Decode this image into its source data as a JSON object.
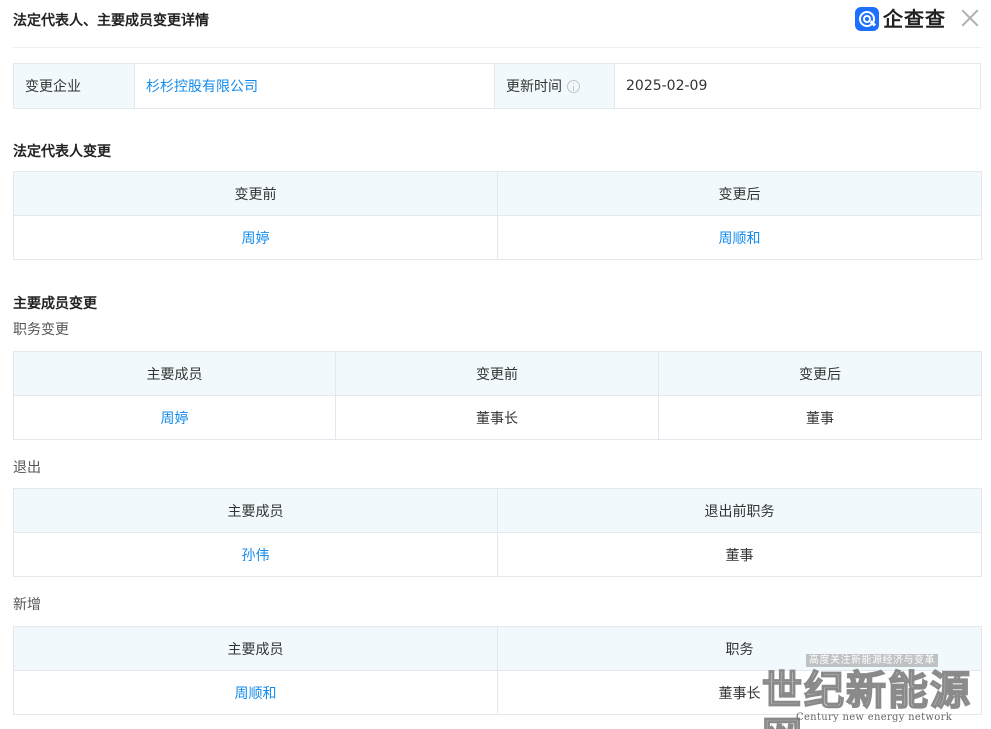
{
  "header": {
    "title": "法定代表人、主要成员变更详情",
    "brand": "企查查",
    "close_icon": "close-icon"
  },
  "info": {
    "company_label": "变更企业",
    "company_value": "杉杉控股有限公司",
    "update_label": "更新时间",
    "update_value": "2025-02-09"
  },
  "legal_rep": {
    "title": "法定代表人变更",
    "headers": [
      "变更前",
      "变更后"
    ],
    "row": [
      "周婷",
      "周顺和"
    ]
  },
  "members": {
    "title": "主要成员变更",
    "position_change": {
      "title": "职务变更",
      "headers": [
        "主要成员",
        "变更前",
        "变更后"
      ],
      "row": [
        "周婷",
        "董事长",
        "董事"
      ]
    },
    "exit": {
      "title": "退出",
      "headers": [
        "主要成员",
        "退出前职务"
      ],
      "row": [
        "孙伟",
        "董事"
      ]
    },
    "added": {
      "title": "新增",
      "headers": [
        "主要成员",
        "职务"
      ],
      "row": [
        "周顺和",
        "董事长"
      ]
    }
  },
  "watermark": {
    "top": "高度关注新能源经济与变革",
    "main": "世纪新能源网",
    "sub": "Century new energy network"
  },
  "colors": {
    "link": "#128bed",
    "header_bg": "#f2f9fc",
    "border": "#e4e8ee",
    "brand": "#1c6fff"
  }
}
